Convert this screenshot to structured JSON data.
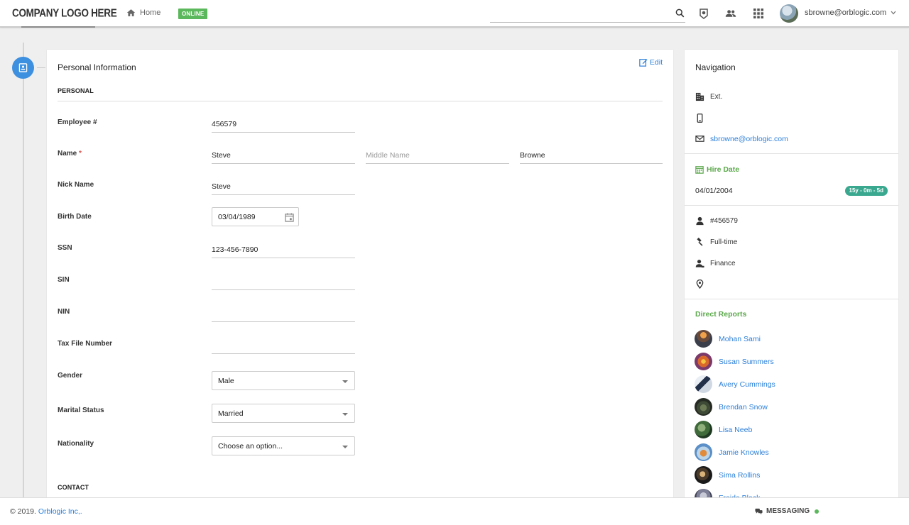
{
  "header": {
    "logo": "COMPANY LOGO HERE",
    "home_label": "Home",
    "status_badge": "ONLINE",
    "search_placeholder": "",
    "user_email": "sbrowne@orblogic.com"
  },
  "main": {
    "title": "Personal Information",
    "edit_label": "Edit",
    "section_personal": "PERSONAL",
    "section_contact": "CONTACT",
    "fields": {
      "employee_no": {
        "label": "Employee #",
        "value": "456579"
      },
      "name": {
        "label": "Name",
        "required_mark": "*",
        "first": "Steve",
        "middle_placeholder": "Middle Name",
        "last": "Browne"
      },
      "nick_name": {
        "label": "Nick Name",
        "value": "Steve"
      },
      "birth_date": {
        "label": "Birth Date",
        "value": "03/04/1989"
      },
      "ssn": {
        "label": "SSN",
        "value": "123-456-7890"
      },
      "sin": {
        "label": "SIN",
        "value": ""
      },
      "nin": {
        "label": "NIN",
        "value": ""
      },
      "tax_file_number": {
        "label": "Tax File Number",
        "value": ""
      },
      "gender": {
        "label": "Gender",
        "value": "Male"
      },
      "marital_status": {
        "label": "Marital Status",
        "value": "Married"
      },
      "nationality": {
        "label": "Nationality",
        "value": "Choose an option..."
      }
    }
  },
  "navigation": {
    "title": "Navigation",
    "ext_label": "Ext.",
    "phone": "",
    "email": "sbrowne@orblogic.com",
    "hire_date_title": "Hire Date",
    "hire_date": "04/01/2004",
    "tenure": "15y - 0m - 5d",
    "employee_id": "#456579",
    "employment_type": "Full-time",
    "department": "Finance",
    "location": "",
    "direct_reports_title": "Direct Reports",
    "direct_reports": [
      "Mohan Sami",
      "Susan Summers",
      "Avery Cummings",
      "Brendan Snow",
      "Lisa Neeb",
      "Jamie Knowles",
      "Sima Rollins",
      "Freida Black"
    ]
  },
  "footer": {
    "copyright_prefix": "© 2019.",
    "company_link": "Orblogic Inc,.",
    "messaging_label": "MESSAGING"
  },
  "colors": {
    "accent": "#2b7fd9",
    "online": "#5cb85c",
    "section_green": "#5ba84b",
    "tenure_badge": "#3aa88f",
    "timeline_dot": "#3d8fe0"
  },
  "icons": [
    "home-icon",
    "search-icon",
    "badge-icon",
    "people-icon",
    "apps-icon",
    "chevron-down-icon",
    "profile-card-icon",
    "edit-icon",
    "calendar-icon",
    "building-icon",
    "phone-icon",
    "mail-icon",
    "person-icon",
    "gavel-icon",
    "department-icon",
    "location-pin-icon",
    "chat-icon"
  ]
}
